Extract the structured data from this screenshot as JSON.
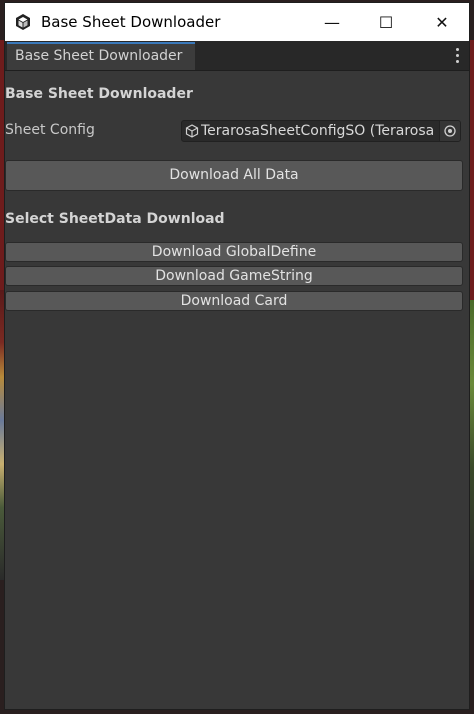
{
  "window": {
    "title": "Base Sheet Downloader",
    "controls": {
      "minimize": "—",
      "maximize": "☐",
      "close": "✕"
    }
  },
  "tab": {
    "label": "Base Sheet Downloader"
  },
  "header": {
    "title": "Base Sheet Downloader"
  },
  "sheet_config": {
    "label": "Sheet Config",
    "value": "TerarosaSheetConfigSO (Terarosa Sheet Config SO)"
  },
  "actions": {
    "download_all": "Download All Data"
  },
  "select_section": {
    "title": "Select SheetData Download",
    "buttons": [
      "Download GlobalDefine",
      "Download GameString",
      "Download Card"
    ]
  },
  "colors": {
    "accent": "#3a79bb",
    "panel": "#383838",
    "button": "#585858"
  },
  "icons": {
    "app": "unity-logo-icon",
    "object": "scriptable-object-icon",
    "picker": "object-picker-icon",
    "menu": "kebab-menu-icon"
  }
}
